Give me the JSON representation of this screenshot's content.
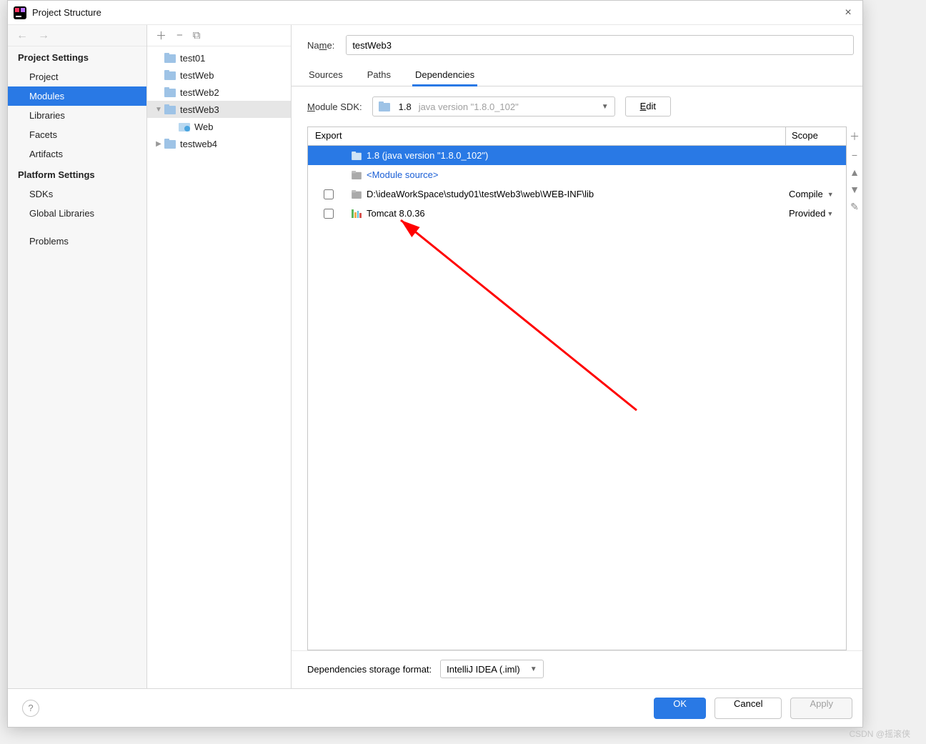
{
  "window": {
    "title": "Project Structure"
  },
  "sidebar": {
    "sections": [
      {
        "title": "Project Settings",
        "items": [
          "Project",
          "Modules",
          "Libraries",
          "Facets",
          "Artifacts"
        ],
        "selected": "Modules"
      },
      {
        "title": "Platform Settings",
        "items": [
          "SDKs",
          "Global Libraries"
        ]
      },
      {
        "title": "",
        "items": [
          "Problems"
        ]
      }
    ]
  },
  "tree": {
    "items": [
      {
        "name": "test01",
        "depth": 0,
        "icon": "folder"
      },
      {
        "name": "testWeb",
        "depth": 0,
        "icon": "folder"
      },
      {
        "name": "testWeb2",
        "depth": 0,
        "icon": "folder"
      },
      {
        "name": "testWeb3",
        "depth": 0,
        "icon": "folder",
        "expanded": true,
        "selected": true
      },
      {
        "name": "Web",
        "depth": 1,
        "icon": "web"
      },
      {
        "name": "testweb4",
        "depth": 0,
        "icon": "folder",
        "expandable": true
      }
    ]
  },
  "name": {
    "label": "Name:",
    "value": "testWeb3"
  },
  "tabs": {
    "items": [
      "Sources",
      "Paths",
      "Dependencies"
    ],
    "active": "Dependencies"
  },
  "sdk": {
    "label": "Module SDK:",
    "value": "1.8",
    "secondary": "java version \"1.8.0_102\"",
    "edit": "Edit"
  },
  "deps": {
    "head": {
      "export": "Export",
      "scope": "Scope"
    },
    "rows": [
      {
        "icon": "folder-blue",
        "name": "1.8 (java version \"1.8.0_102\")",
        "checkbox": false,
        "selected": true
      },
      {
        "icon": "folder-gray",
        "name": "<Module source>",
        "checkbox": false,
        "class": "blue-link"
      },
      {
        "icon": "folder-gray",
        "name": "D:\\ideaWorkSpace\\study01\\testWeb3\\web\\WEB-INF\\lib",
        "checkbox": true,
        "scope": "Compile"
      },
      {
        "icon": "bars",
        "name": "Tomcat 8.0.36",
        "checkbox": true,
        "scope": "Provided"
      }
    ]
  },
  "storage": {
    "label": "Dependencies storage format:",
    "value": "IntelliJ IDEA (.iml)"
  },
  "footer": {
    "ok": "OK",
    "cancel": "Cancel",
    "apply": "Apply"
  },
  "watermark": "CSDN @摇滚侠"
}
